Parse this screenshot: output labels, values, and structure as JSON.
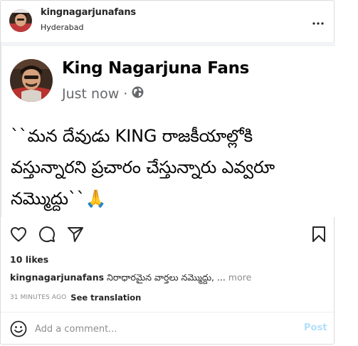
{
  "post": {
    "username": "kingnagarjunafans",
    "location": "Hyderabad",
    "likes": "10 likes",
    "caption_user": "kingnagarjunafans",
    "caption_text": "నిరాధారమైన వార్తలు నమ్మొద్దు, ...",
    "caption_more": "more",
    "time_ago": "31 MINUTES AGO",
    "see_translation": "See translation"
  },
  "media": {
    "page_name": "King Nagarjuna Fans",
    "timestamp": "Just now",
    "separator": "·",
    "post_line_1": "``మన దేవుడు KING రాజకీయాల్లోకి",
    "post_line_2": "వస్తున్నారని ప్రచారం చేస్తున్నారు ఎవ్వరూ",
    "post_line_3": "నమ్మొద్దు``",
    "post_emoji": "🙏"
  },
  "comment": {
    "placeholder": "Add a comment...",
    "post_label": "Post"
  },
  "colors": {
    "text": "#262626",
    "secondary": "#8e8e8e",
    "post_button_disabled": "#b2dffc",
    "fb_meta": "#65676b",
    "border": "#dbdbdb"
  },
  "icons": {
    "more": "more-horizontal-icon",
    "like": "heart-icon",
    "comment": "comment-bubble-icon",
    "share": "paper-plane-icon",
    "save": "bookmark-icon",
    "emoji": "smiley-icon",
    "privacy": "globe-icon"
  }
}
